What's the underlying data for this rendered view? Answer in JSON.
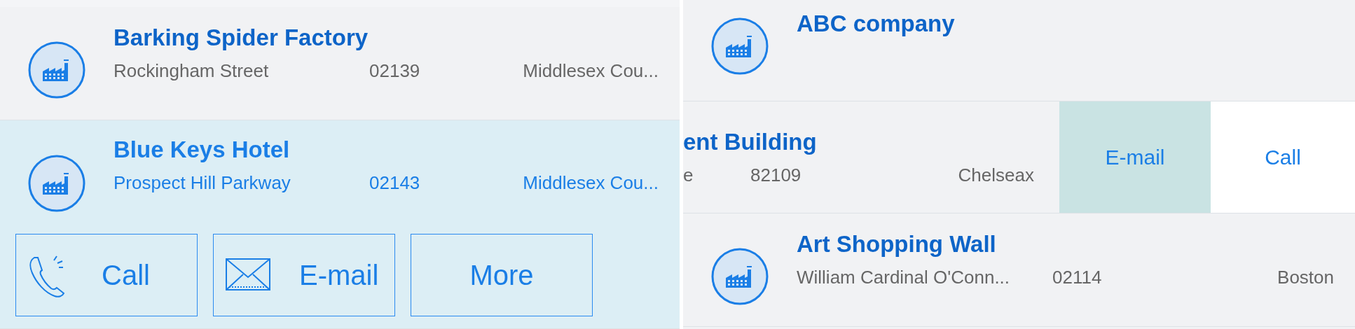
{
  "panels": [
    {
      "rows": [
        {
          "kind": "normal",
          "selected": false,
          "title": "Barking Spider Factory",
          "address": "Rockingham Street",
          "zip": "02139",
          "county": "Middlesex Cou..."
        },
        {
          "kind": "normal",
          "selected": true,
          "title": "Blue Keys Hotel",
          "address": "Prospect Hill Parkway",
          "zip": "02143",
          "county": "Middlesex Cou...",
          "actions": [
            {
              "kind": "call",
              "label": "Call"
            },
            {
              "kind": "email",
              "label": "E-mail"
            },
            {
              "kind": "more",
              "label": "More"
            }
          ]
        }
      ]
    },
    {
      "rows": [
        {
          "kind": "normal",
          "selected": false,
          "title": "ABC company"
        },
        {
          "kind": "swiped",
          "selected": false,
          "title": "ent Building",
          "address": "e",
          "zip": "82109",
          "county": "Chelseax",
          "swipe_actions": [
            {
              "kind": "email",
              "label": "E-mail"
            },
            {
              "kind": "call",
              "label": "Call"
            }
          ]
        },
        {
          "kind": "normal",
          "selected": false,
          "title": "Art Shopping Wall",
          "address": "William Cardinal O'Conn...",
          "zip": "02114",
          "county": "Boston"
        }
      ]
    }
  ]
}
